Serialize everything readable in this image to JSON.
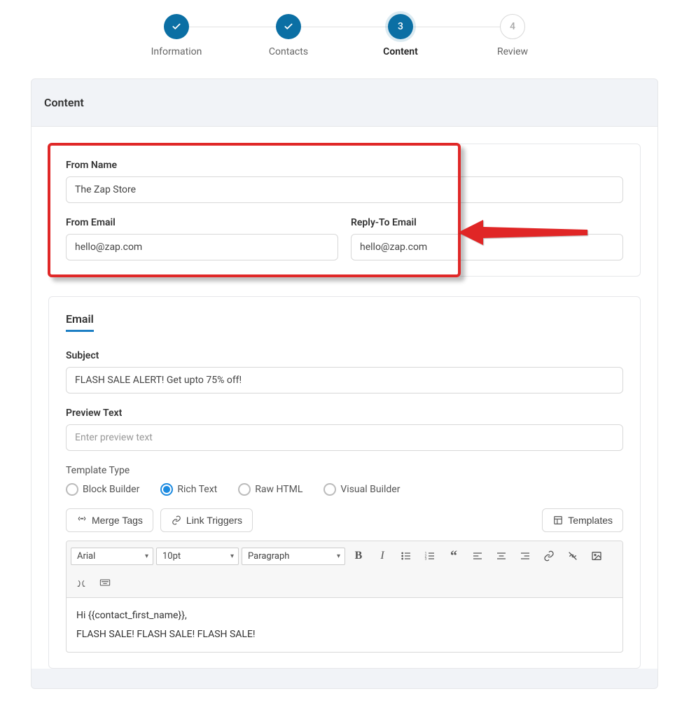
{
  "stepper": {
    "steps": [
      {
        "label": "Information",
        "state": "done",
        "mark": "check"
      },
      {
        "label": "Contacts",
        "state": "done",
        "mark": "check"
      },
      {
        "label": "Content",
        "state": "current",
        "mark": "3"
      },
      {
        "label": "Review",
        "state": "future",
        "mark": "4"
      }
    ]
  },
  "card": {
    "title": "Content"
  },
  "from": {
    "name_label": "From Name",
    "name_value": "The Zap Store",
    "email_label": "From Email",
    "email_value": "hello@zap.com",
    "reply_label": "Reply-To Email",
    "reply_value": "hello@zap.com"
  },
  "email": {
    "section_title": "Email",
    "subject_label": "Subject",
    "subject_value": "FLASH SALE ALERT! Get upto 75% off!",
    "preview_label": "Preview Text",
    "preview_placeholder": "Enter preview text",
    "template_type_label": "Template Type",
    "template_types": [
      {
        "label": "Block Builder",
        "selected": false
      },
      {
        "label": "Rich Text",
        "selected": true
      },
      {
        "label": "Raw HTML",
        "selected": false
      },
      {
        "label": "Visual Builder",
        "selected": false
      }
    ],
    "merge_tags_label": "Merge Tags",
    "link_triggers_label": "Link Triggers",
    "templates_label": "Templates",
    "toolbar": {
      "font": "Arial",
      "size": "10pt",
      "block": "Paragraph"
    },
    "body_line1": "Hi {{contact_first_name}},",
    "body_line2": "FLASH SALE! FLASH SALE! FLASH SALE!"
  }
}
